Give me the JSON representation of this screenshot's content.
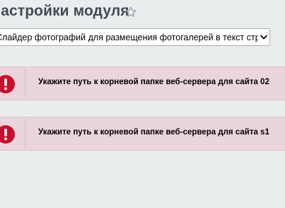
{
  "header": {
    "title": "Настройки модуля",
    "favorite_icon": "star-icon"
  },
  "module_select": {
    "value": "Слайдер фотографий для размещения фотогалерей в текст страниц"
  },
  "alerts": [
    {
      "icon": "error-icon",
      "text": "Укажите путь к корневой папке веб-сервера для сайта 02"
    },
    {
      "icon": "error-icon",
      "text": "Укажите путь к корневой папке веб-сервера для сайта s1"
    }
  ],
  "colors": {
    "page_background": "#eaedee",
    "alert_background": "#e9d5da",
    "error_icon": "#c8102e",
    "title_text": "#3f4b54"
  }
}
